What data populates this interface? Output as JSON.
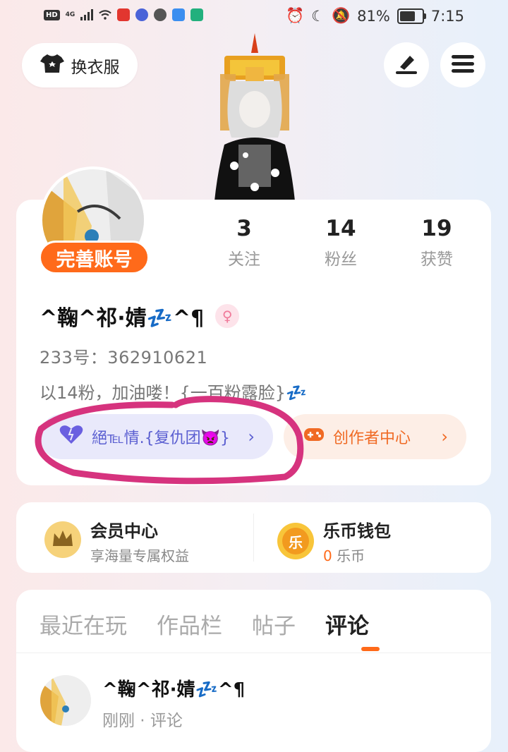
{
  "status_bar": {
    "hd": "HD",
    "network": "4G",
    "battery_percent": "81%",
    "battery_level": 0.81,
    "time": "7:15"
  },
  "header": {
    "dress_up_label": "换衣服"
  },
  "profile": {
    "complete_account_label": "完善账号",
    "stats": [
      {
        "value": "3",
        "label": "关注"
      },
      {
        "value": "14",
        "label": "粉丝"
      },
      {
        "value": "19",
        "label": "获赞"
      }
    ],
    "nickname": "^鞠^祁·婧💤^¶",
    "gender_symbol": "♀",
    "uid": "233号：362910621",
    "bio": "以14粉，加油喽！{一百粉露脸}💤",
    "group_pill": {
      "label": "絕℡情.{复仇团👿}",
      "chevron": "›"
    },
    "creator_pill": {
      "label": "创作者中心",
      "chevron": "›"
    }
  },
  "wallet": {
    "vip": {
      "title": "会员中心",
      "subtitle": "享海量专属权益"
    },
    "coins": {
      "title": "乐币钱包",
      "amount": "0",
      "unit": " 乐币",
      "icon_char": "乐"
    }
  },
  "tabs": [
    {
      "label": "最近在玩",
      "active": false
    },
    {
      "label": "作品栏",
      "active": false
    },
    {
      "label": "帖子",
      "active": false
    },
    {
      "label": "评论",
      "active": true
    }
  ],
  "comment": {
    "name": "^鞠^祁·婧💤^¶",
    "meta": "刚刚 · 评论"
  },
  "colors": {
    "accent_orange": "#ff6a1a",
    "group_purple": "#5b5fd1",
    "annotation_pink": "#d6337e"
  }
}
